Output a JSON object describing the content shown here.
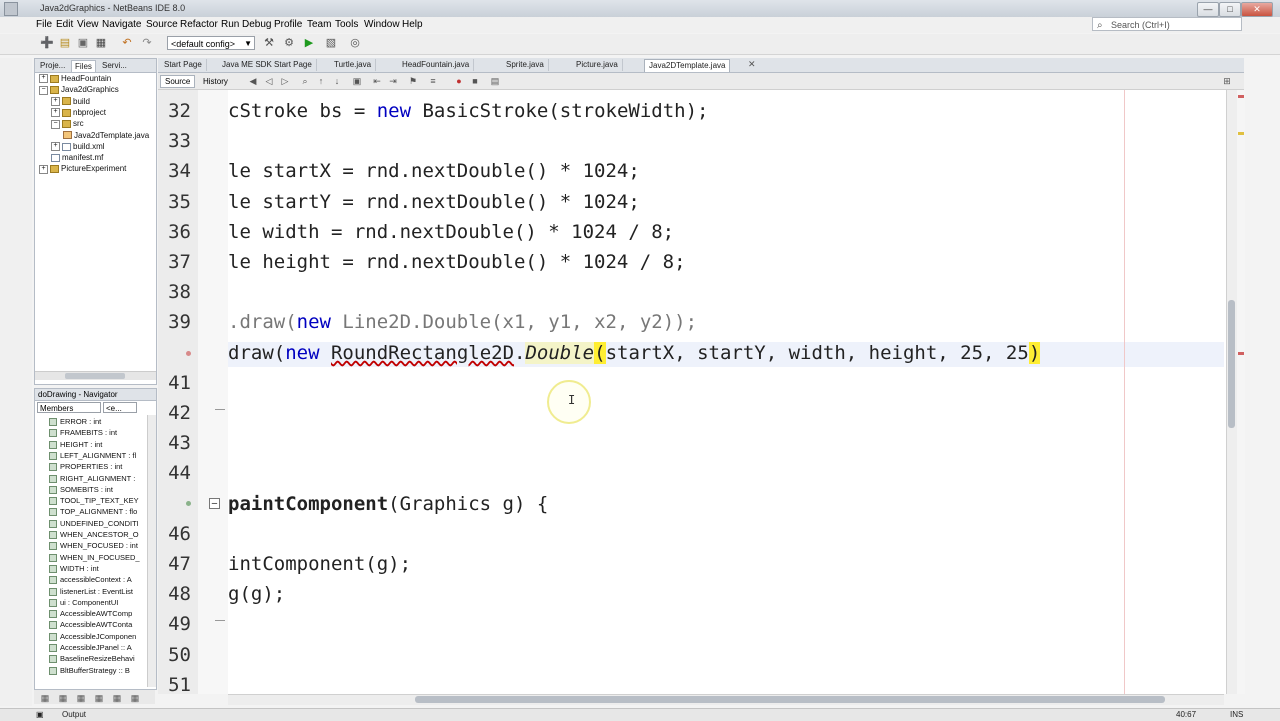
{
  "window": {
    "title": "Java2dGraphics - NetBeans IDE 8.0"
  },
  "window_buttons": [
    "—",
    "□",
    "✕"
  ],
  "menu": [
    "File",
    "Edit",
    "View",
    "Navigate",
    "Source",
    "Refactor",
    "Run",
    "Debug",
    "Profile",
    "Team",
    "Tools",
    "Window",
    "Help"
  ],
  "search": {
    "placeholder": "Search (Ctrl+I)"
  },
  "toolbar": {
    "config": "<default config>"
  },
  "project_tabs": [
    "Proje...",
    "Files",
    "Servi..."
  ],
  "project_tree": [
    {
      "label": "HeadFountain",
      "indent": 0,
      "type": "folder",
      "exp": "+"
    },
    {
      "label": "Java2dGraphics",
      "indent": 0,
      "type": "folder",
      "exp": "−"
    },
    {
      "label": "build",
      "indent": 1,
      "type": "folder",
      "exp": "+"
    },
    {
      "label": "nbproject",
      "indent": 1,
      "type": "folder",
      "exp": "+"
    },
    {
      "label": "src",
      "indent": 1,
      "type": "folder",
      "exp": "−"
    },
    {
      "label": "Java2dTemplate.java",
      "indent": 2,
      "type": "java",
      "exp": ""
    },
    {
      "label": "build.xml",
      "indent": 1,
      "type": "file",
      "exp": "+"
    },
    {
      "label": "manifest.mf",
      "indent": 1,
      "type": "file",
      "exp": ""
    },
    {
      "label": "PictureExperiment",
      "indent": 0,
      "type": "folder",
      "exp": "+"
    }
  ],
  "navigator": {
    "title": "doDrawing - Navigator",
    "filter": "Members",
    "filter2": "<e...",
    "items": [
      "ERROR : int",
      "FRAMEBITS : int",
      "HEIGHT : int",
      "LEFT_ALIGNMENT : fl",
      "PROPERTIES : int",
      "RIGHT_ALIGNMENT :",
      "SOMEBITS : int",
      "TOOL_TIP_TEXT_KEY",
      "TOP_ALIGNMENT : flo",
      "UNDEFINED_CONDITI",
      "WHEN_ANCESTOR_O",
      "WHEN_FOCUSED : int",
      "WHEN_IN_FOCUSED_",
      "WIDTH : int",
      "accessibleContext : A",
      "listenerList : EventList",
      "ui : ComponentUI",
      "AccessibleAWTComp",
      "AccessibleAWTConta",
      "AccessibleJComponen",
      "AccessibleJPanel :: A",
      "BaselineResizeBehavi",
      "BltBufferStrategy :: B"
    ]
  },
  "editor_tabs": [
    "Start Page",
    "Java ME SDK Start Page",
    "Turtle.java",
    "HeadFountain.java",
    "Sprite.java",
    "Picture.java",
    "Java2DTemplate.java"
  ],
  "editor_mode": {
    "source": "Source",
    "history": "History"
  },
  "code_lines": [
    {
      "num": "32",
      "text": "cStroke bs = new BasicStroke(strokeWidth);"
    },
    {
      "num": "33",
      "text": ""
    },
    {
      "num": "34",
      "text": "le startX = rnd.nextDouble() * 1024;"
    },
    {
      "num": "35",
      "text": "le startY = rnd.nextDouble() * 1024;"
    },
    {
      "num": "36",
      "text": "le width = rnd.nextDouble() * 1024 / 8;"
    },
    {
      "num": "37",
      "text": "le height = rnd.nextDouble() * 1024 / 8;"
    },
    {
      "num": "38",
      "text": ""
    },
    {
      "num": "39",
      "text": ".draw(new Line2D.Double(x1, y1, x2, y2));"
    },
    {
      "num": "",
      "text": "draw(new RoundRectangle2D.Double(startX, startY, width, height, 25, 25)"
    },
    {
      "num": "41",
      "text": ""
    },
    {
      "num": "42",
      "text": ""
    },
    {
      "num": "43",
      "text": ""
    },
    {
      "num": "44",
      "text": ""
    },
    {
      "num": "",
      "text": "paintComponent(Graphics g) {"
    },
    {
      "num": "46",
      "text": ""
    },
    {
      "num": "47",
      "text": "intComponent(g);"
    },
    {
      "num": "48",
      "text": "g(g);"
    },
    {
      "num": "49",
      "text": ""
    },
    {
      "num": "50",
      "text": ""
    },
    {
      "num": "51",
      "text": ""
    }
  ],
  "status": {
    "output": "Output",
    "position": "40:67",
    "mode": "INS"
  },
  "colors": {
    "keyword": "#0000c0",
    "brace_highlight": "#ffee33",
    "error": "#c00000"
  }
}
